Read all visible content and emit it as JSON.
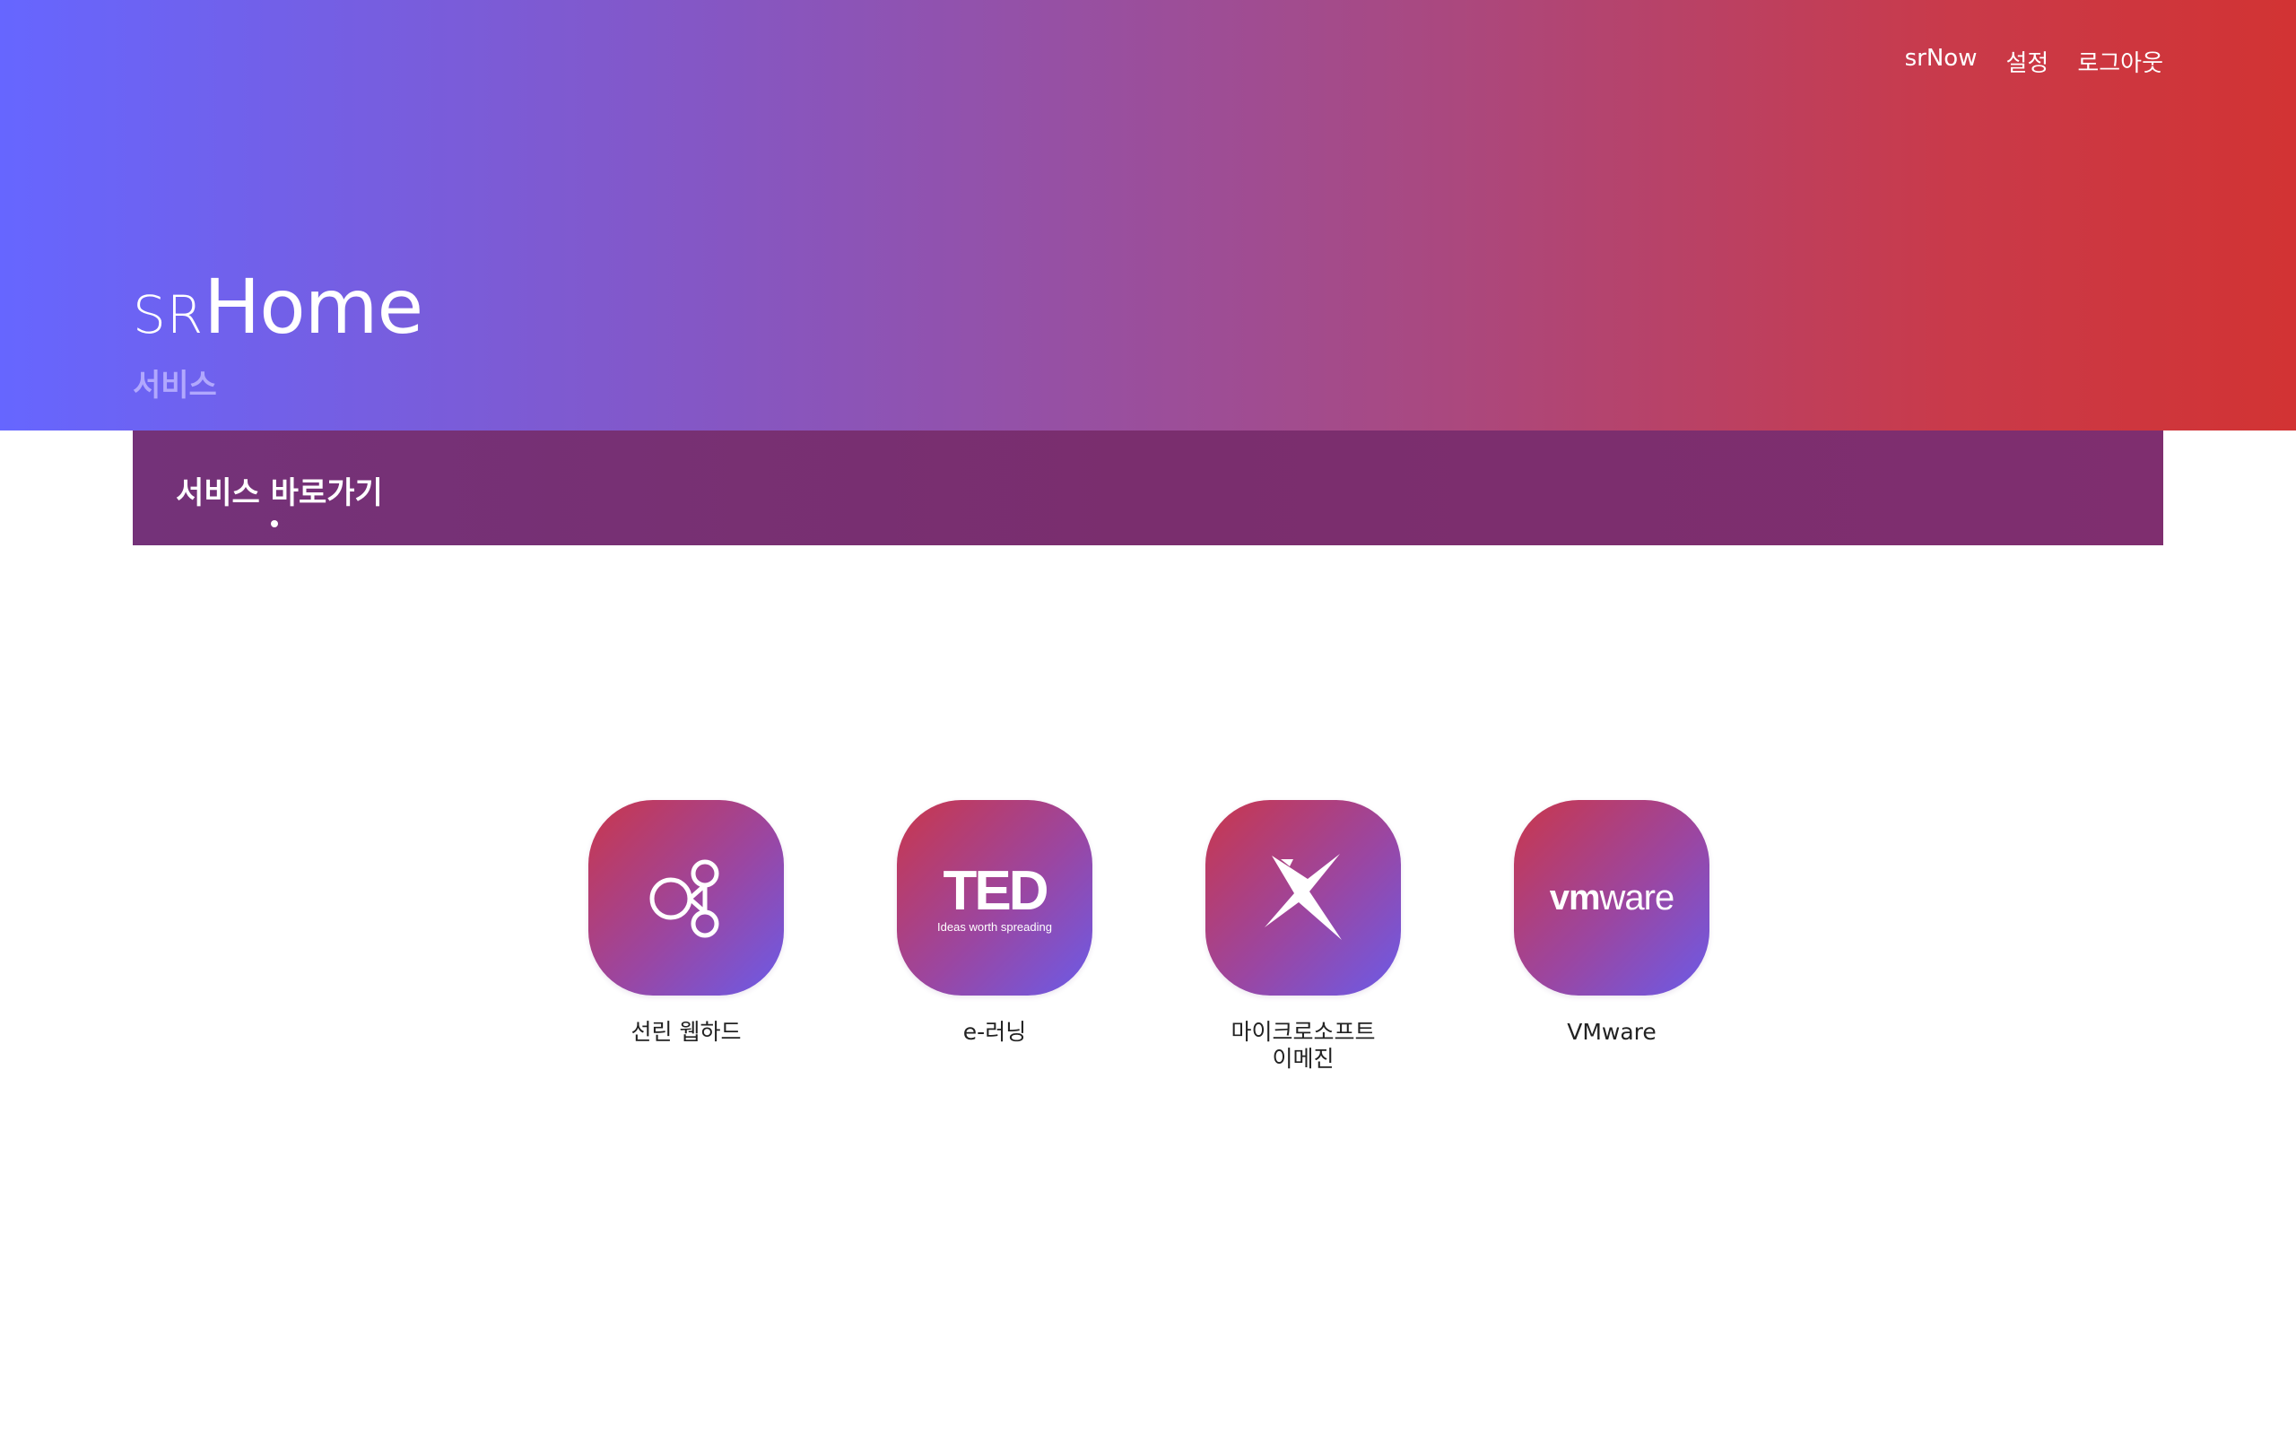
{
  "nav": {
    "links": [
      {
        "label": "srNow"
      },
      {
        "label": "설정"
      },
      {
        "label": "로그아웃"
      }
    ]
  },
  "brand": {
    "prefix": "SR",
    "name": "Home",
    "subtitle": "서비스"
  },
  "section": {
    "title": "서비스 바로가기"
  },
  "services": [
    {
      "label": "선린 웹하드",
      "icon": "molecule-nodes-icon"
    },
    {
      "label": "e-러닝",
      "icon": "ted-logo-icon",
      "logo_text": "TED",
      "logo_tagline": "Ideas worth spreading"
    },
    {
      "label": "마이크로소프트\n이메진",
      "icon": "imagine-x-icon"
    },
    {
      "label": "VMware",
      "icon": "vmware-logo-icon",
      "logo_vm": "vm",
      "logo_ware": "ware"
    }
  ],
  "colors": {
    "hero_start": "#6666ff",
    "hero_end": "#d23333",
    "section_bar": "#7a2e6e",
    "tile_start": "#c9374c",
    "tile_end": "#6b5be8"
  }
}
